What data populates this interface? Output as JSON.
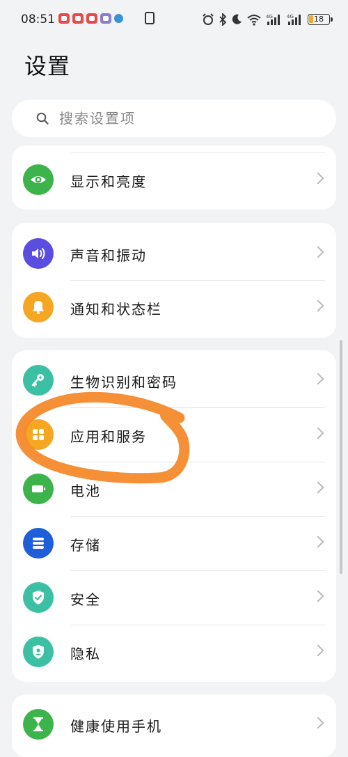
{
  "status_bar": {
    "time": "08:51",
    "battery": "18"
  },
  "title": "设置",
  "search": {
    "placeholder": "搜索设置项"
  },
  "groups": [
    {
      "items": [
        {
          "label": "显示和亮度",
          "icon": "eye-icon",
          "color": "#3cb44b"
        }
      ]
    },
    {
      "items": [
        {
          "label": "声音和振动",
          "icon": "speaker-icon",
          "color": "#5b4de0"
        },
        {
          "label": "通知和状态栏",
          "icon": "bell-icon",
          "color": "#f5a623"
        }
      ]
    },
    {
      "items": [
        {
          "label": "生物识别和密码",
          "icon": "key-icon",
          "color": "#3cc0a4"
        },
        {
          "label": "应用和服务",
          "icon": "apps-grid-icon",
          "color": "#f5a623"
        },
        {
          "label": "电池",
          "icon": "battery-icon",
          "color": "#3cb44b"
        },
        {
          "label": "存储",
          "icon": "storage-icon",
          "color": "#1e5ed8"
        },
        {
          "label": "安全",
          "icon": "shield-icon",
          "color": "#3cc0a4"
        },
        {
          "label": "隐私",
          "icon": "privacy-icon",
          "color": "#3cc0a4"
        }
      ]
    },
    {
      "items": [
        {
          "label": "健康使用手机",
          "icon": "hourglass-icon",
          "color": "#3cb44b"
        }
      ]
    }
  ],
  "annotation_color": "#f68a2c"
}
